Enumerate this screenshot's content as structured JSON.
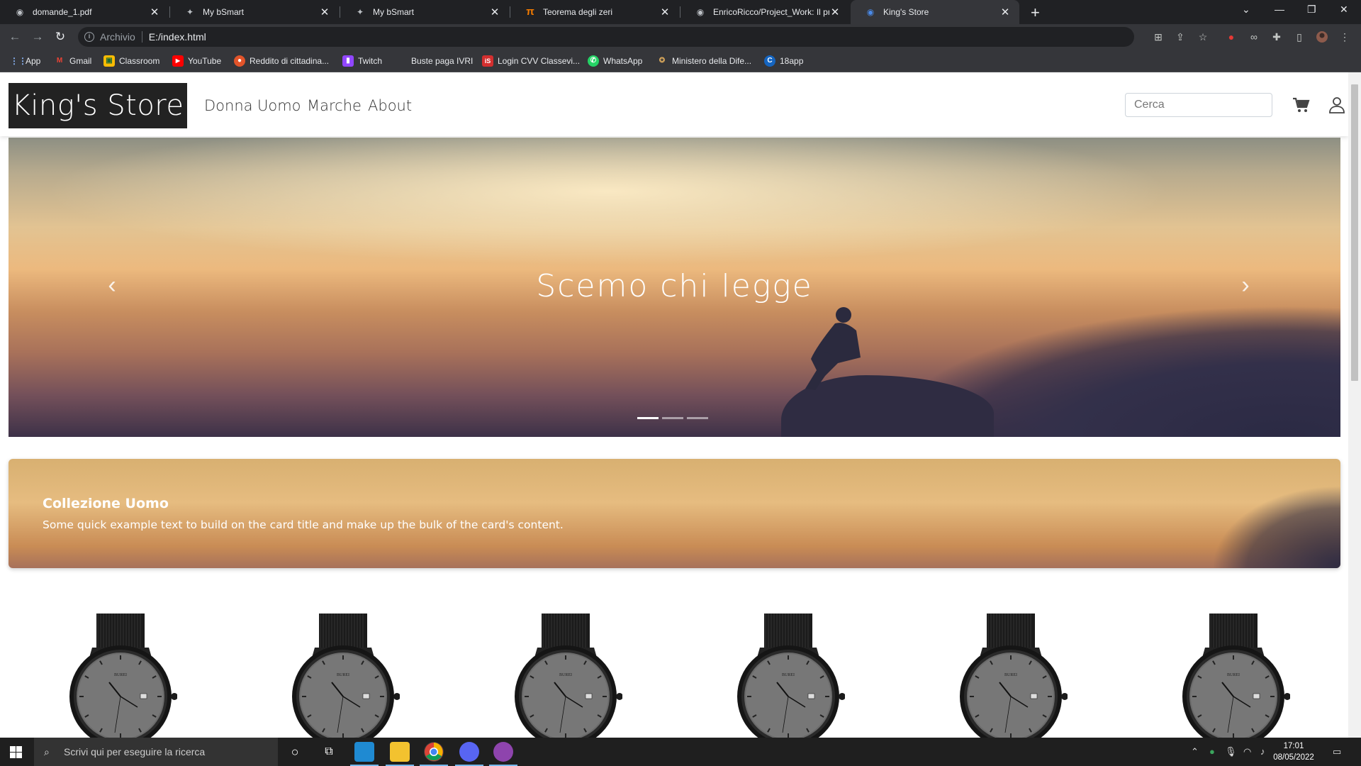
{
  "browser": {
    "tabs": [
      {
        "label": "domande_1.pdf",
        "icon": "github-icon"
      },
      {
        "label": "My bSmart",
        "icon": "bsmart-icon"
      },
      {
        "label": "My bSmart",
        "icon": "bsmart-icon"
      },
      {
        "label": "Teorema degli zeri",
        "icon": "pi-icon"
      },
      {
        "label": "EnricoRicco/Project_Work: Il proje",
        "icon": "github-icon"
      },
      {
        "label": "King's Store",
        "icon": "site-icon"
      }
    ],
    "address": {
      "chip": "Archivio",
      "url": "E:/index.html"
    },
    "bookmarks": [
      {
        "label": "App"
      },
      {
        "label": "Gmail"
      },
      {
        "label": "Classroom"
      },
      {
        "label": "YouTube"
      },
      {
        "label": "Reddito di cittadina..."
      },
      {
        "label": "Twitch"
      },
      {
        "label": "Buste paga IVRI"
      },
      {
        "label": "Login CVV Classevi..."
      },
      {
        "label": "WhatsApp"
      },
      {
        "label": "Ministero della Dife..."
      },
      {
        "label": "18app"
      }
    ]
  },
  "site": {
    "brand": "King's Store",
    "nav": [
      "Donna",
      "Uomo",
      "Marche",
      "About"
    ],
    "search_placeholder": "Cerca",
    "carousel": {
      "caption": "Scemo chi legge",
      "slides": 3,
      "active": 0
    },
    "collection": {
      "title": "Collezione Uomo",
      "text": "Some quick example text to build on the card title and make up the bulk of the card's content."
    },
    "watch_brand": "BUREI"
  },
  "taskbar": {
    "search_placeholder": "Scrivi qui per eseguire la ricerca",
    "time": "17:01",
    "date": "08/05/2022"
  },
  "colors": {
    "brand_bg": "#222222",
    "chrome_dark": "#202124",
    "taskbar": "#1f1f1f"
  }
}
